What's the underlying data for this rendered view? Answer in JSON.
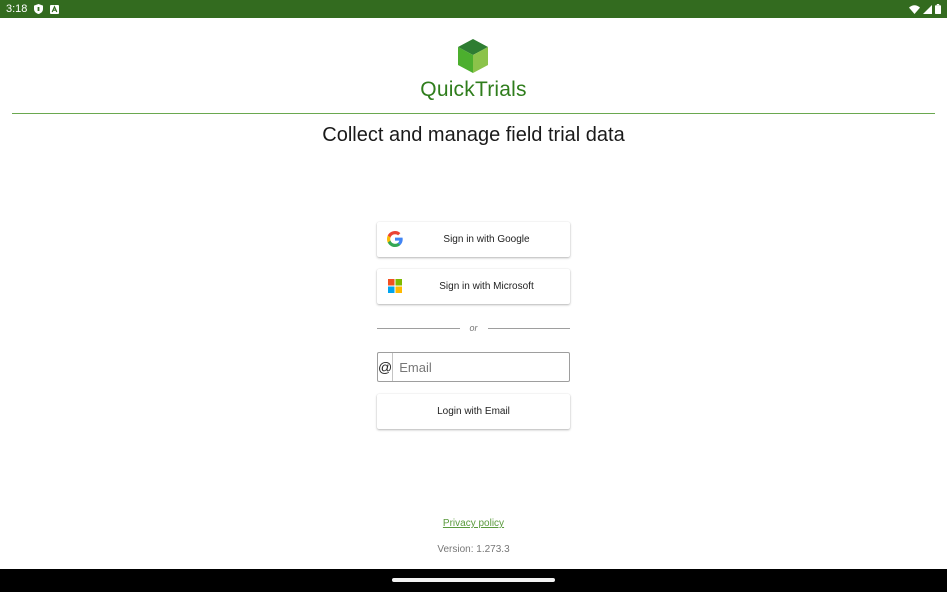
{
  "status_bar": {
    "time": "3:18",
    "left_icons": [
      "shield-icon",
      "app-notification-icon"
    ],
    "right_icons": [
      "wifi-icon",
      "signal-icon",
      "battery-icon"
    ]
  },
  "brand": {
    "logo_icon": "cube-logo-icon",
    "name": "QuickTrials",
    "color": "#2f7d1c",
    "accent": "#6aa84f"
  },
  "tagline": "Collect and manage field trial data",
  "sign_in": {
    "google_label": "Sign in with Google",
    "microsoft_label": "Sign in with Microsoft",
    "or_label": "or",
    "email_prefix_icon": "at-sign-icon",
    "email_placeholder": "Email",
    "email_value": "",
    "email_login_label": "Login with Email"
  },
  "footer": {
    "privacy_label": "Privacy policy",
    "version_label": "Version: 1.273.3"
  }
}
